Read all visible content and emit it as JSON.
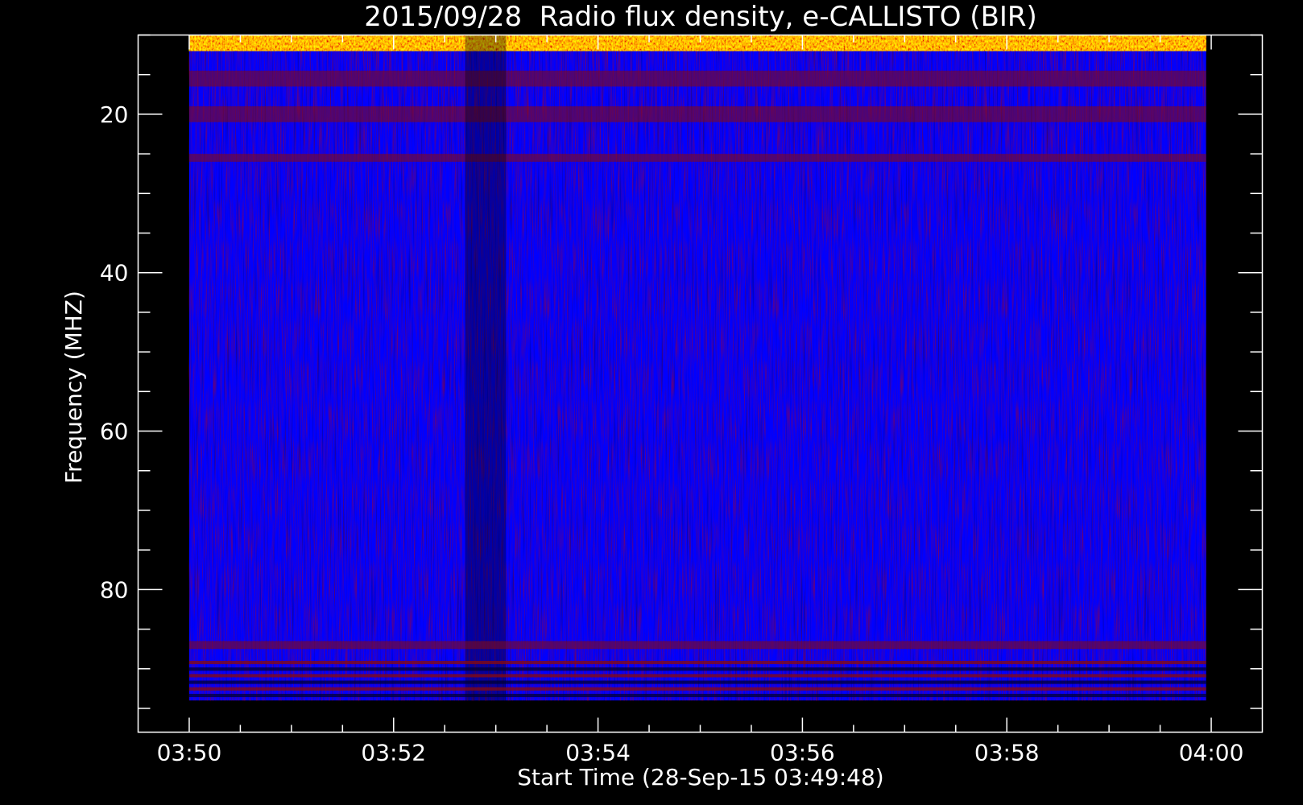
{
  "chart_data": {
    "type": "heatmap",
    "title": "2015/09/28  Radio flux density, e-CALLISTO (BIR)",
    "xlabel": "Start Time (28-Sep-15 03:49:48)",
    "ylabel": "Frequency (MHZ)",
    "x_tick_labels": [
      "03:50",
      "03:52",
      "03:54",
      "03:56",
      "03:58",
      "04:00"
    ],
    "x_ticks_min": [
      0,
      2,
      4,
      6,
      8,
      10
    ],
    "xlim_min": [
      -0.5,
      10.5
    ],
    "data_xlim_min": [
      0,
      9.95
    ],
    "y_tick_labels": [
      "20",
      "40",
      "60",
      "80"
    ],
    "y_ticks": [
      20,
      40,
      60,
      80
    ],
    "ylim": [
      10,
      98
    ],
    "data_ylim": [
      10,
      94
    ],
    "y_reversed": true,
    "grid": false,
    "colormap": [
      "#000000",
      "#0000ff",
      "#8a0a0a",
      "#ff2000",
      "#ffdd00"
    ],
    "features": [
      {
        "kind": "hband",
        "freq": [
          10,
          12
        ],
        "level": "hot"
      },
      {
        "kind": "hband",
        "freq": [
          14.5,
          16.5
        ],
        "level": "red"
      },
      {
        "kind": "hband",
        "freq": [
          19,
          21
        ],
        "level": "red"
      },
      {
        "kind": "hband",
        "freq": [
          25,
          26
        ],
        "level": "red"
      },
      {
        "kind": "vband",
        "t": [
          2.7,
          3.1
        ],
        "level": "dark"
      },
      {
        "kind": "hband",
        "freq": [
          86.5,
          87.5
        ],
        "level": "red"
      },
      {
        "kind": "hband",
        "freq": [
          89,
          94
        ],
        "level": "mixed"
      }
    ]
  }
}
